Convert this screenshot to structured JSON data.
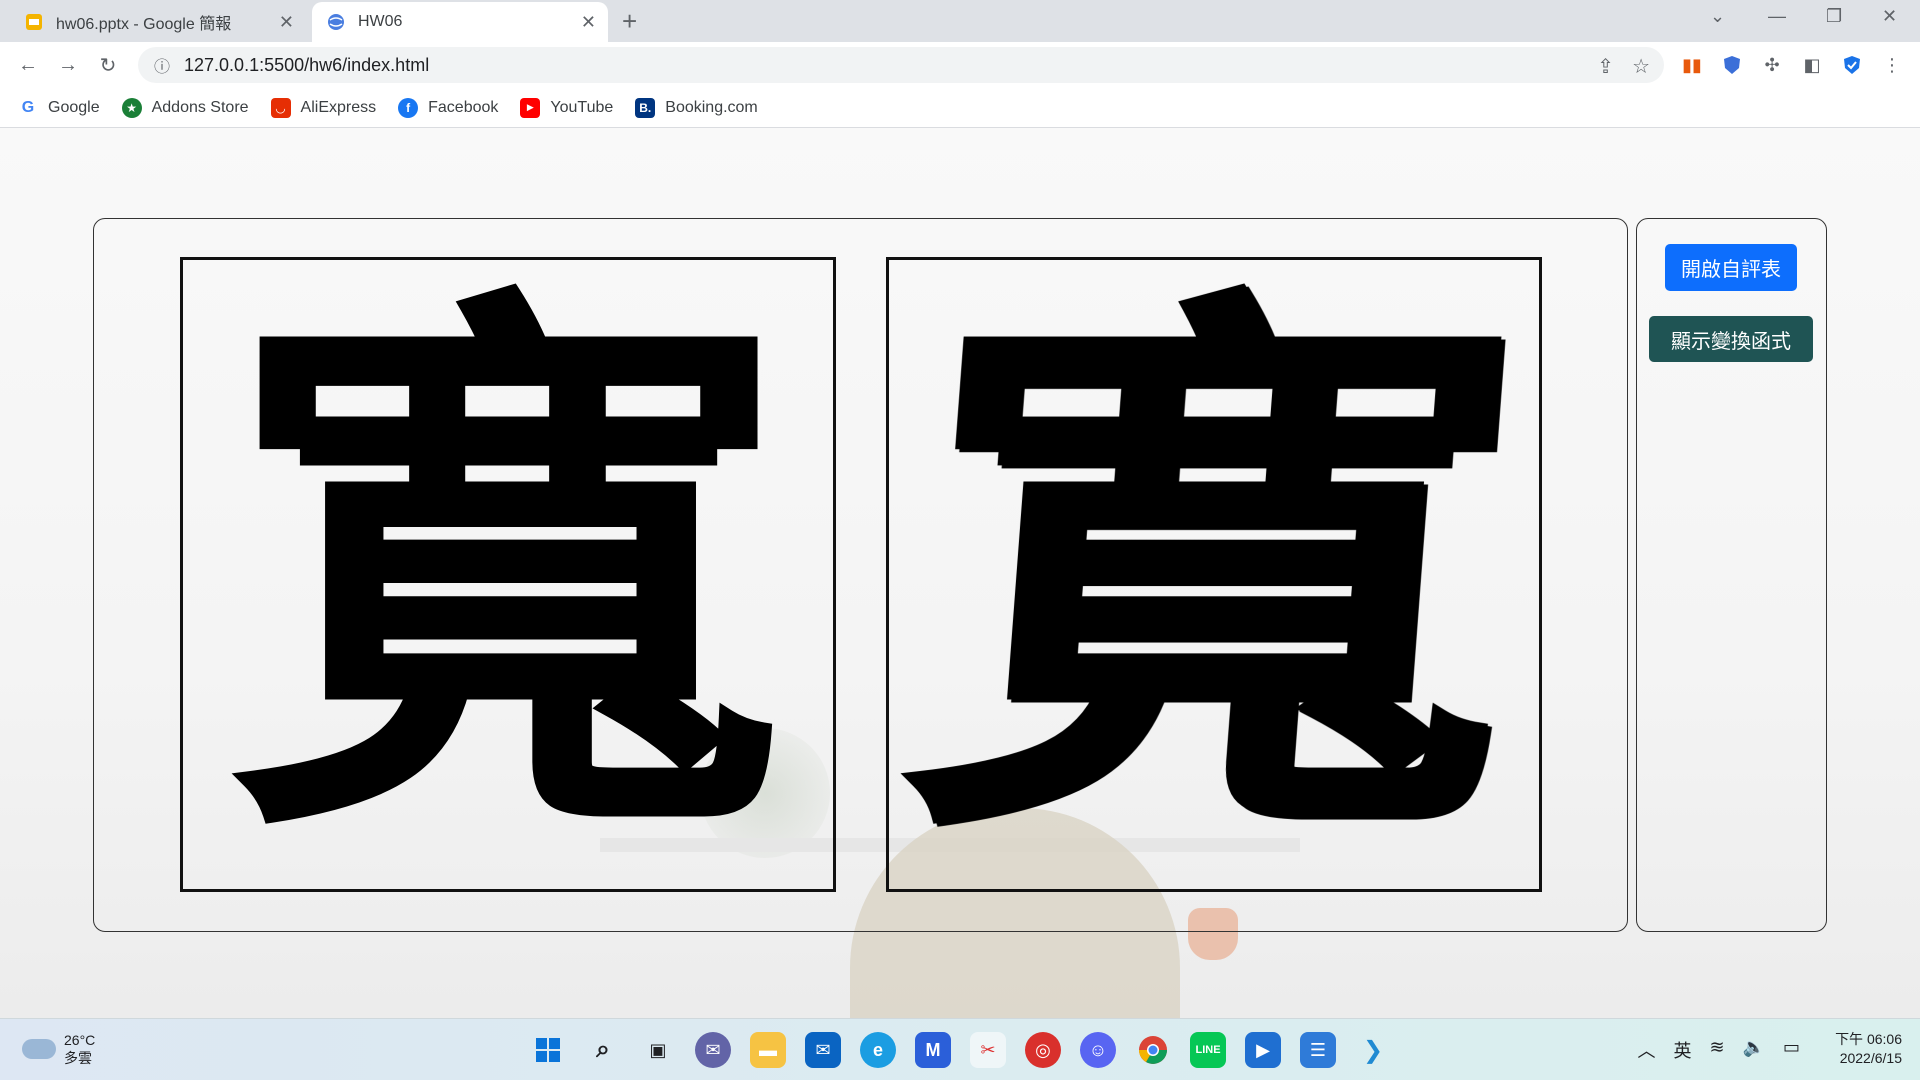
{
  "browser": {
    "tabs": [
      {
        "title": "hw06.pptx - Google 簡報",
        "active": false,
        "favicon": "slides-icon"
      },
      {
        "title": "HW06",
        "active": true,
        "favicon": "globe-icon"
      }
    ],
    "url": "127.0.0.1:5500/hw6/index.html",
    "bookmarks": [
      {
        "label": "Google",
        "icon": "google-icon",
        "color": "#4285f4"
      },
      {
        "label": "Addons Store",
        "icon": "addons-icon",
        "color": "#1a7f37"
      },
      {
        "label": "AliExpress",
        "icon": "aliexpress-icon",
        "color": "#e62e04"
      },
      {
        "label": "Facebook",
        "icon": "facebook-icon",
        "color": "#1877f2"
      },
      {
        "label": "YouTube",
        "icon": "youtube-icon",
        "color": "#ff0000"
      },
      {
        "label": "Booking.com",
        "icon": "booking-icon",
        "color": "#003580"
      }
    ]
  },
  "main": {
    "original_char": "寬",
    "transformed_char": "寬",
    "buttons": {
      "open_eval": "開啟自評表",
      "show_transform": "顯示變換函式"
    },
    "colors": {
      "primary": "#0d6efd",
      "dark": "#1f5454"
    }
  },
  "taskbar": {
    "weather": {
      "temp": "26°C",
      "desc": "多雲"
    },
    "ime": "英",
    "time": "下午 06:06",
    "date": "2022/6/15"
  }
}
